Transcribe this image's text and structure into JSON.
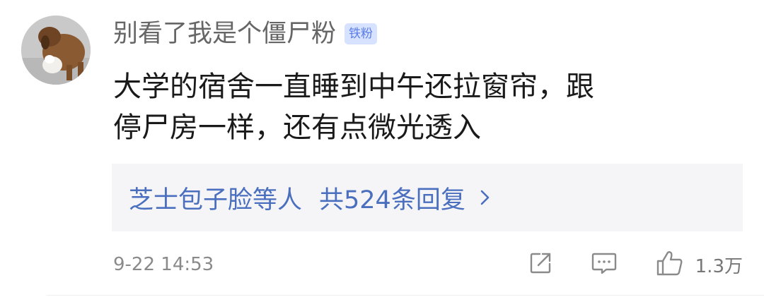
{
  "comment": {
    "username": "别看了我是个僵尸粉",
    "badge": "铁粉",
    "text_line1": "大学的宿舍一直睡到中午还拉窗帘，跟",
    "text_line2": "停尸房一样，还有点微光透入",
    "replies": {
      "who": "芝士包子脸等人",
      "total": "共524条回复"
    },
    "timestamp": "9-22 14:53",
    "likes": "1.3万"
  },
  "icons": {
    "share": "share-icon",
    "comment": "comment-icon",
    "like": "thumbs-up-icon",
    "chevron": "chevron-right-icon"
  },
  "colors": {
    "link": "#4a6fbf",
    "badge_bg": "#d6e2ff",
    "badge_text": "#5b7ee6"
  }
}
